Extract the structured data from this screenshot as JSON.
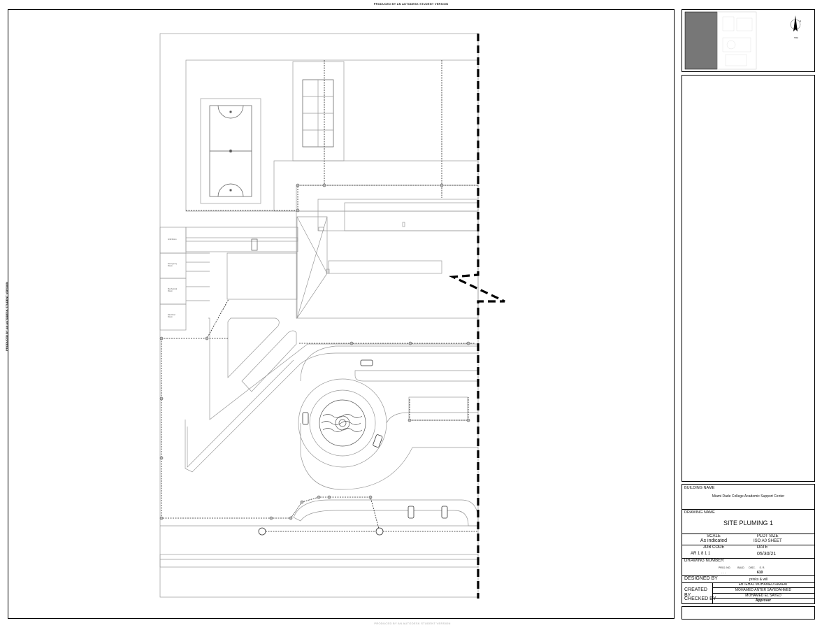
{
  "watermark": {
    "top": "PRODUCED BY AN AUTODESK STUDENT VERSION",
    "side": "PRODUCED BY AN AUTODESK STUDENT VERSION"
  },
  "plan_labels": {
    "room1": "Grid Room",
    "room2": "Emergency Room",
    "room3": "Mechanical Room",
    "room4": "Electrical Room"
  },
  "key_plan": {
    "north_label": "N",
    "north_caption": "TRU"
  },
  "title_block": {
    "building_name_label": "BUILDING NAME",
    "building_name": "Miami Dade College Academic Support Center",
    "drawing_name_label": "DRAWING NAME",
    "drawing_name": "SITE PLUMING 1",
    "scale_label": "SCALE",
    "scale_value": "As indicated",
    "plot_size_label": "PLOT SIZE",
    "plot_size_value": "ISO  A0  SHEET",
    "job_code_label": "JOB CODE",
    "job_code_value": "AR   1   8   1   1",
    "date_label": "DATE",
    "date_value": "05/30/21",
    "drawing_number_label": "DRAWING NUMBER",
    "dn_headers": "PROJ. NO.          BULD.      DISC.      S. R.",
    "dn_stub": "- - -",
    "dn_value": "610",
    "designed_by_label": "DESIGNED BY",
    "designed_by_value": "prinks & will",
    "created_by_label": "CREATED BY",
    "created_by_1": "EBTEHAL MOHAMED RAAFAT",
    "created_by_2": "MOHAMED ANTER SAYEDAHMED",
    "checked_by_label": "CHECKED BY",
    "checked_by_value": "MOHAMED EL SAYED",
    "approver": "Approver"
  }
}
